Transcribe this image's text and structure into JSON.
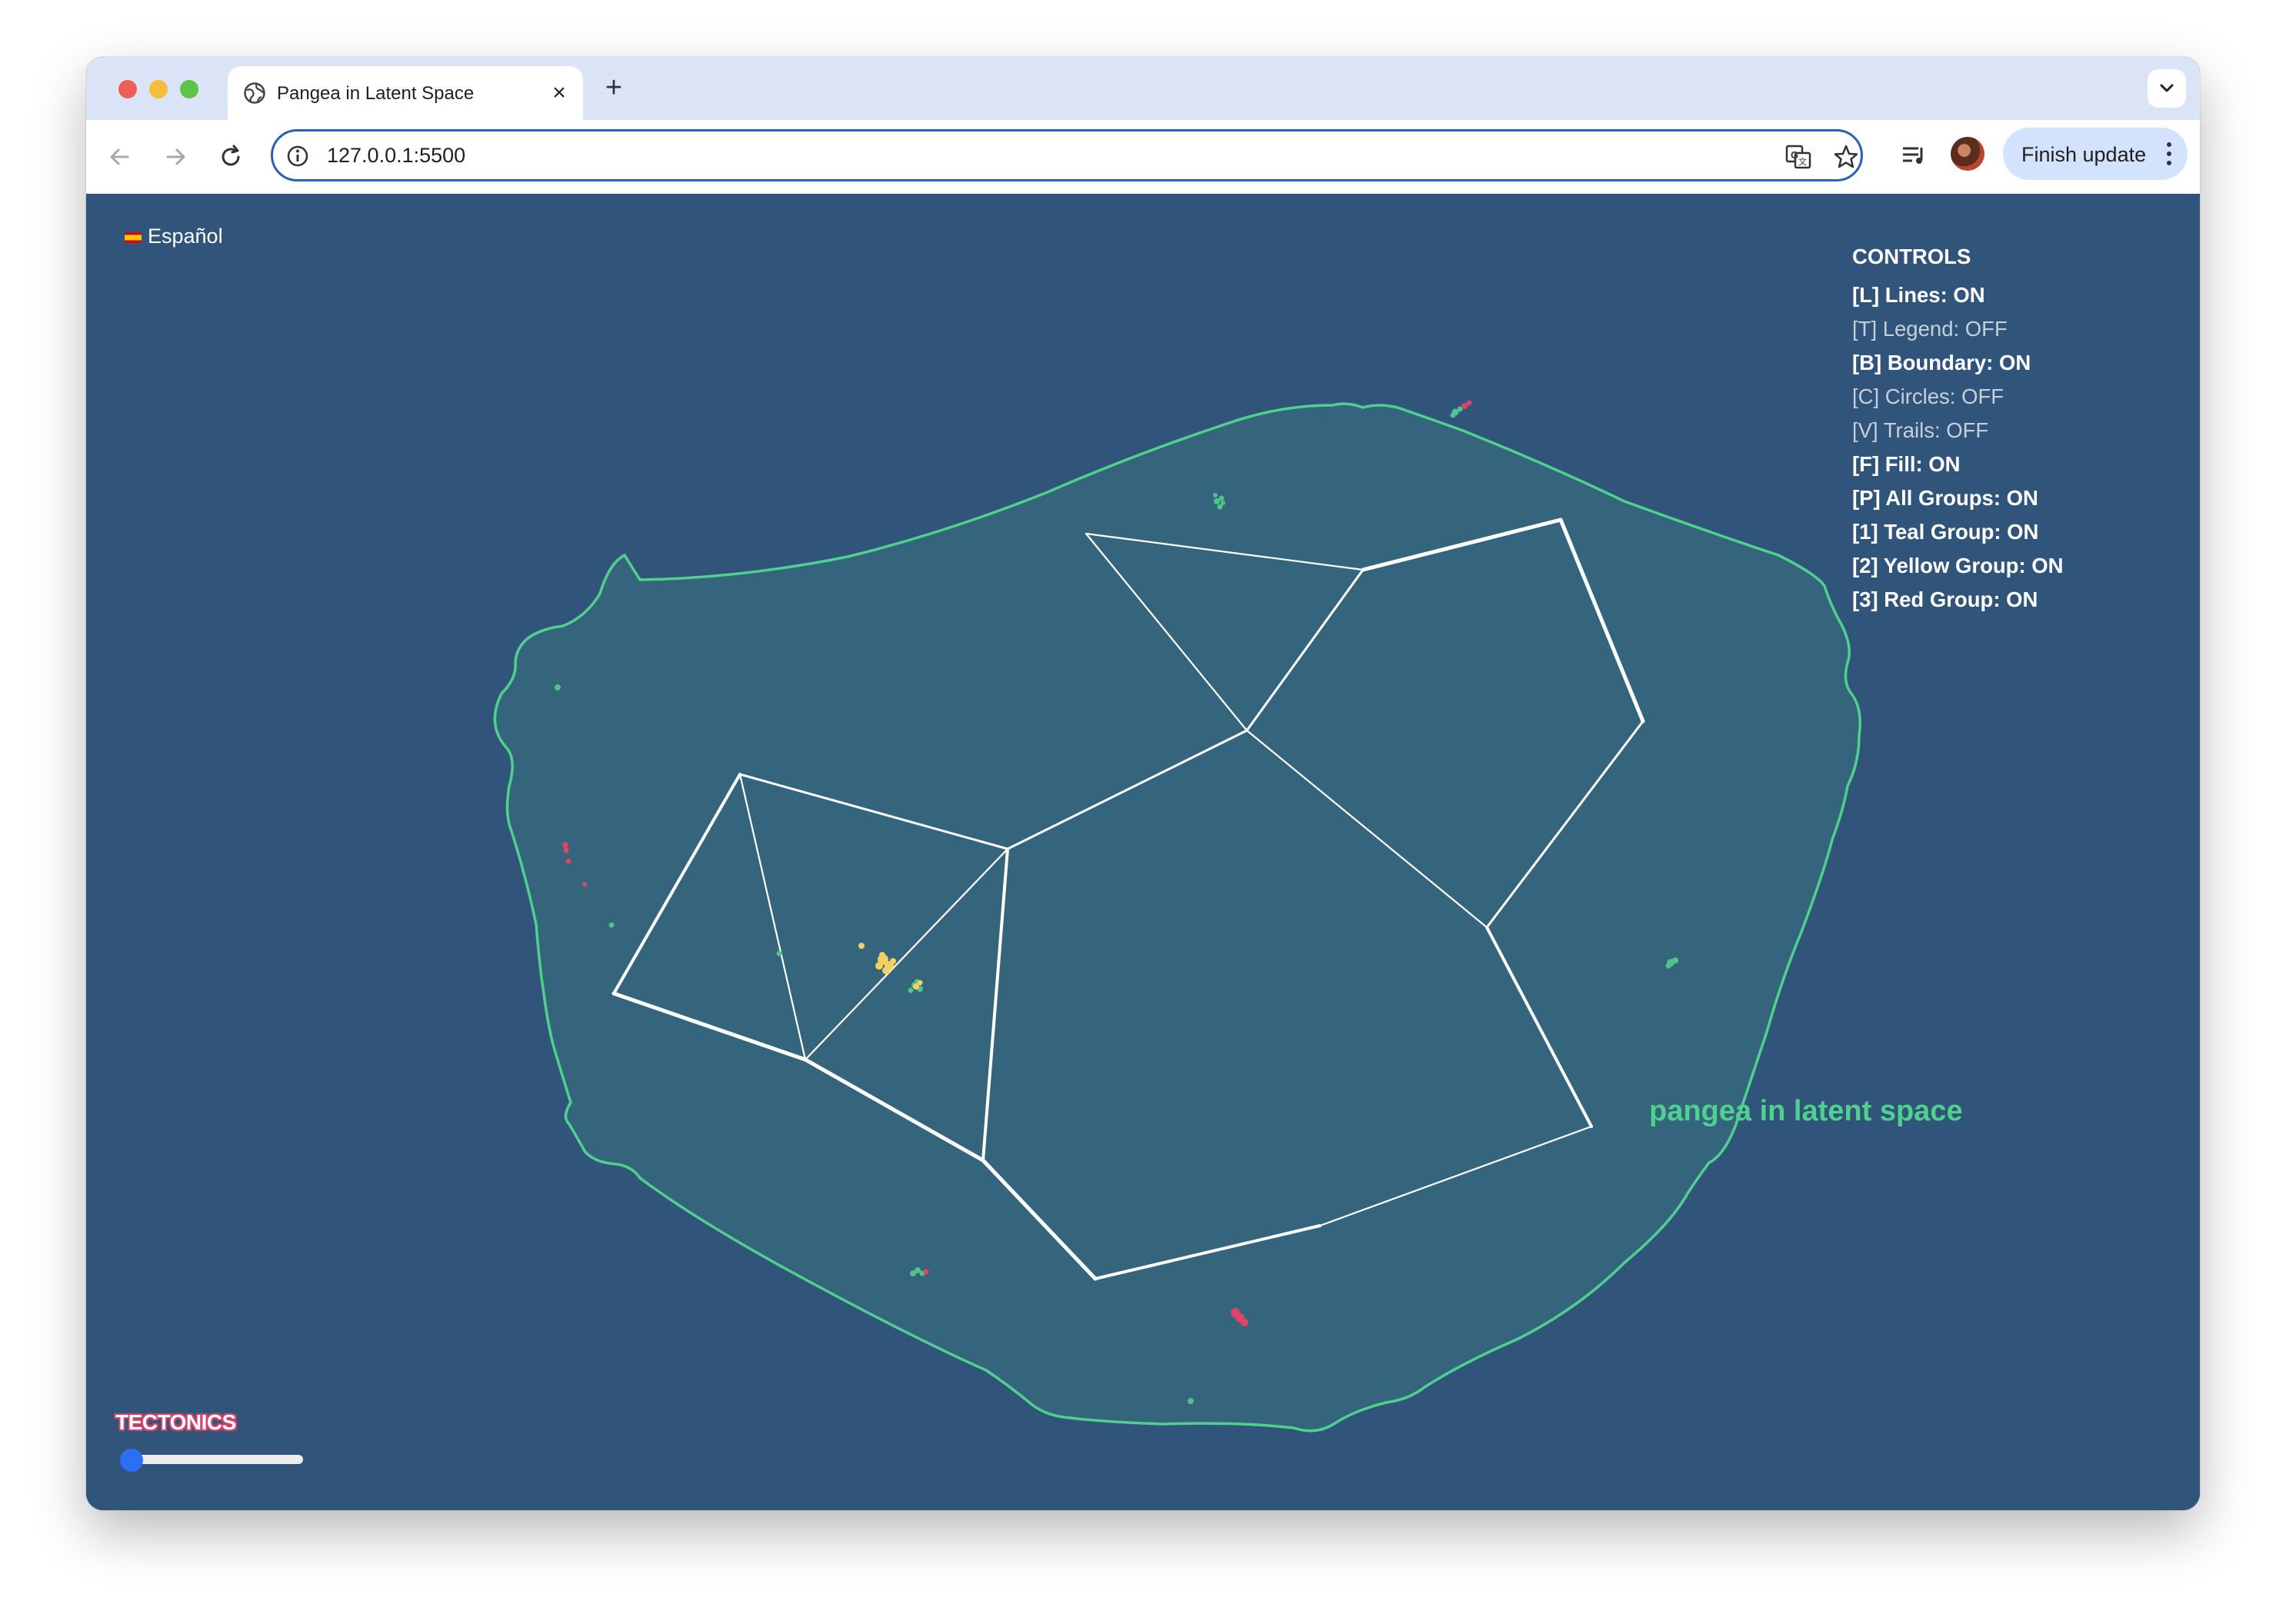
{
  "browser": {
    "tab_title": "Pangea in Latent Space",
    "url": "127.0.0.1:5500",
    "finish_update_label": "Finish update"
  },
  "page": {
    "language_toggle": "Español",
    "controls": {
      "heading": "CONTROLS",
      "items": [
        {
          "label": "[L] Lines: ON",
          "state": "on"
        },
        {
          "label": "[T] Legend: OFF",
          "state": "off"
        },
        {
          "label": "[B] Boundary: ON",
          "state": "on"
        },
        {
          "label": "[C] Circles: OFF",
          "state": "off"
        },
        {
          "label": "[V] Trails: OFF",
          "state": "off"
        },
        {
          "label": "[F] Fill: ON",
          "state": "on"
        },
        {
          "label": "[P] All Groups: ON",
          "state": "on"
        },
        {
          "label": "[1] Teal Group: ON",
          "state": "on"
        },
        {
          "label": "[2] Yellow Group: ON",
          "state": "on"
        },
        {
          "label": "[3] Red Group: ON",
          "state": "on"
        }
      ]
    },
    "map_label": "pangea in latent space",
    "tectonics_label": "TECTONICS",
    "tectonics_slider_value": 0
  },
  "colors": {
    "background": "#31547a",
    "landmass_fill": "#35657d",
    "boundary": "#4fd08f",
    "lines": "#ffffff",
    "teal_group": "#4fc38a",
    "yellow_group": "#f2d15f",
    "red_group": "#e0436a",
    "accent": "#2b6ff5"
  }
}
